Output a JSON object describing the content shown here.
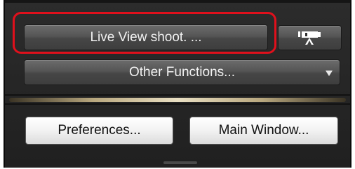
{
  "panel": {
    "live_view_button": {
      "label": "Live View shoot. ..."
    },
    "movie_button": {
      "icon": "movie-camera-icon"
    },
    "other_functions": {
      "label": "Other Functions...",
      "icon": "dropdown-arrow-icon"
    },
    "preferences_button": {
      "label": "Preferences..."
    },
    "main_window_button": {
      "label": "Main Window..."
    }
  },
  "colors": {
    "highlight": "#e0101c",
    "panel_background": "#262626",
    "divider_accent": "#e9dfc2"
  }
}
